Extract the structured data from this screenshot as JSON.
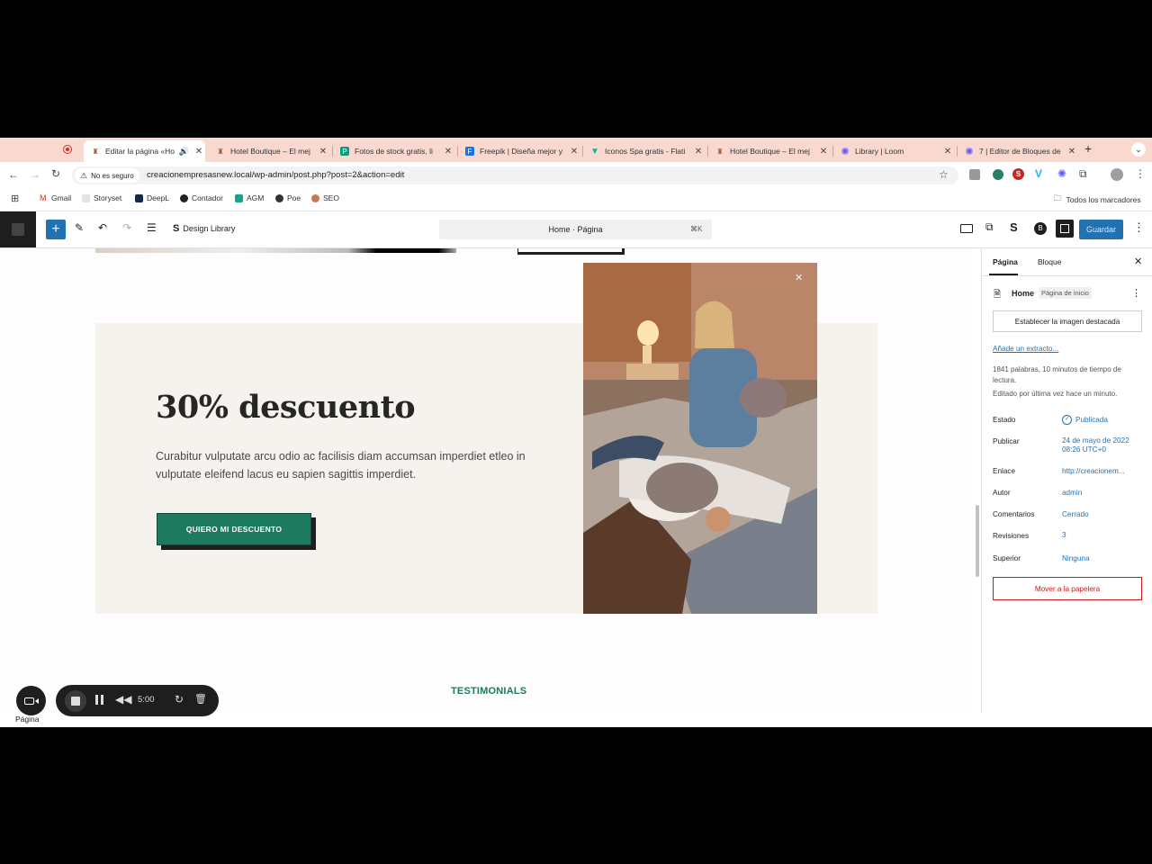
{
  "browser": {
    "tabs": [
      {
        "title": "Editar la página «Ho",
        "active": true,
        "icon": "hotel-favicon"
      },
      {
        "title": "Hotel Boutique – El mej",
        "icon": "hotel-favicon"
      },
      {
        "title": "Fotos de stock gratis, li",
        "icon": "pexels-favicon"
      },
      {
        "title": "Freepik | Diseña mejor y",
        "icon": "freepik-favicon"
      },
      {
        "title": "Iconos Spa gratis - Flati",
        "icon": "flaticon-favicon"
      },
      {
        "title": "Hotel Boutique – El mej",
        "icon": "hotel-favicon"
      },
      {
        "title": "Library | Loom",
        "icon": "loom-favicon"
      },
      {
        "title": "7 | Editor de Bloques de",
        "icon": "loom-favicon"
      }
    ],
    "security_label": "No es seguro",
    "url": "creacionempresasnew.local/wp-admin/post.php?post=2&action=edit",
    "bookmarks": [
      "Gmail",
      "Storyset",
      "DeepL",
      "Contador",
      "AGM",
      "Poe",
      "SEO"
    ],
    "all_bookmarks": "Todos los marcadores"
  },
  "editor": {
    "design_library": "Design Library",
    "command": "Home · Página",
    "shortcut": "⌘K",
    "save": "Guardar"
  },
  "content": {
    "heading": "30% descuento",
    "body": "Curabitur vulputate arcu odio ac facilisis diam accumsan imperdiet etleo in vulputate eleifend lacus eu sapien sagittis imperdiet.",
    "button": "QUIERO MI DESCUENTO",
    "testimonials": "TESTIMONIALS"
  },
  "sidebar": {
    "tab_page": "Página",
    "tab_block": "Bloque",
    "page_title": "Home",
    "page_badge": "Página de inicio",
    "featured_image": "Establecer la imagen destacada",
    "excerpt": "Añade un extracto...",
    "stats": "1841 palabras, 10 minutos de tiempo de lectura.",
    "edited": "Editado por última vez hace un minuto.",
    "rows": [
      {
        "label": "Estado",
        "value": "Publicada"
      },
      {
        "label": "Publicar",
        "value": "24 de mayo de 2022 08:26 UTC+0"
      },
      {
        "label": "Enlace",
        "value": "http://creacionem..."
      },
      {
        "label": "Autor",
        "value": "admin"
      },
      {
        "label": "Comentarios",
        "value": "Cerrado"
      },
      {
        "label": "Revisiones",
        "value": "3"
      },
      {
        "label": "Superior",
        "value": "Ninguna"
      }
    ],
    "trash": "Mover a la papelera"
  },
  "recorder": {
    "time": "5:00",
    "footer_label": "Página"
  },
  "colors": {
    "tab_strip": "#f9d9cf",
    "accent_button": "#1d7a5f",
    "wp_blue": "#2271b1",
    "trash_red": "#cc1818"
  }
}
